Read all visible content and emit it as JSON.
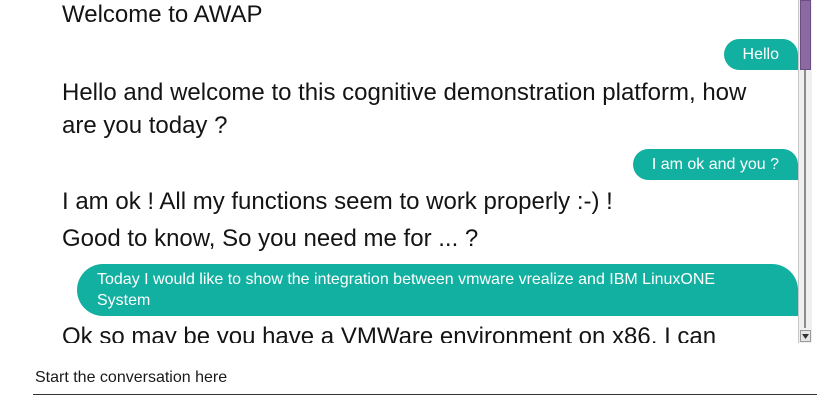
{
  "messages": [
    {
      "from": "bot",
      "text": "Welcome to AWAP"
    },
    {
      "from": "user",
      "text": "Hello"
    },
    {
      "from": "bot",
      "text": "Hello and welcome to this cognitive demonstration platform, how are you today ?"
    },
    {
      "from": "user",
      "text": "I am ok and you ?"
    },
    {
      "from": "bot",
      "text": "I am ok ! All my functions seem to work properly :-) !"
    },
    {
      "from": "bot",
      "text": "Good to know, So you need me for ... ?"
    },
    {
      "from": "user",
      "text": "Today I would like to show the integration between vmware vrealize and IBM LinuxONE System"
    },
    {
      "from": "bot",
      "text": "Ok so may be you have a VMWare environment on x86, I can"
    }
  ],
  "input": {
    "placeholder": "Start the conversation here",
    "value": ""
  },
  "colors": {
    "user_bubble": "#12b0a0",
    "user_text": "#ffffff",
    "bot_text": "#141414",
    "scroll_thumb": "#8a6aa0"
  }
}
